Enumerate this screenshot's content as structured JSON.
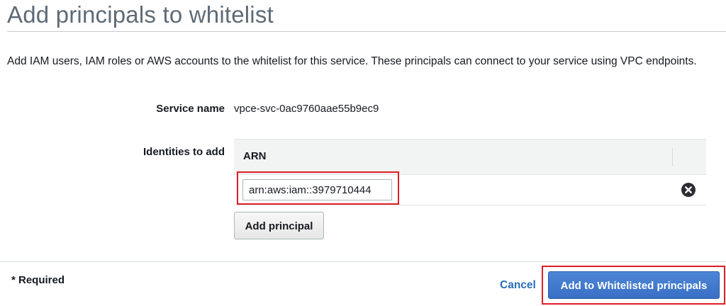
{
  "page": {
    "title": "Add principals to whitelist",
    "description": "Add IAM users, IAM roles or AWS accounts to the whitelist for this service. These principals can connect to your service using VPC endpoints."
  },
  "service": {
    "label": "Service name",
    "value": "vpce-svc-0ac9760aae55b9ec9"
  },
  "identities": {
    "label": "Identities to add",
    "column_header": "ARN",
    "rows": [
      {
        "arn": "arn:aws:iam::3979710444",
        "remove_icon": "remove-circle-x"
      }
    ],
    "add_label": "Add principal"
  },
  "footer": {
    "required_text": "* Required",
    "cancel_label": "Cancel",
    "submit_label": "Add to Whitelisted principals"
  },
  "colors": {
    "title": "#5e6b76",
    "link": "#2a6eba",
    "primary_button": "#3a6fc6",
    "highlight": "#dd1f26"
  }
}
